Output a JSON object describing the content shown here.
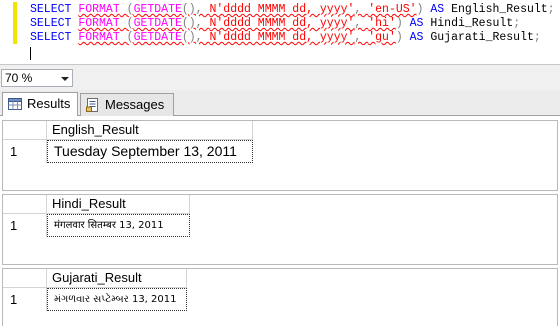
{
  "editor": {
    "lines": [
      {
        "kw1": "SELECT",
        "fn1": "FORMAT",
        "p1": " (",
        "fn2": "GETDATE",
        "p2": "(), ",
        "fmt": "N'dddd MMMM dd, yyyy'",
        "p3": ", ",
        "culture": "'en-US'",
        "p4": ") ",
        "kw2": "AS",
        "alias": " English_Result",
        "end": ";"
      },
      {
        "kw1": "SELECT",
        "fn1": "FORMAT",
        "p1": " (",
        "fn2": "GETDATE",
        "p2": "(), ",
        "fmt": "N'dddd MMMM dd, yyyy'",
        "p3": ", ",
        "culture": "'hi'",
        "p4": ") ",
        "kw2": "AS",
        "alias": " Hindi_Result",
        "end": ";"
      },
      {
        "kw1": "SELECT",
        "fn1": "FORMAT",
        "p1": " (",
        "fn2": "GETDATE",
        "p2": "(), ",
        "fmt": "N'dddd MMMM dd, yyyy'",
        "p3": ", ",
        "culture": "'gu'",
        "p4": ") ",
        "kw2": "AS",
        "alias": " Gujarati_Result",
        "end": ";"
      }
    ],
    "colors": {
      "keyword": "#0000ff",
      "function": "#ff00ff",
      "string": "#ff0000",
      "change_bar": "#f2e400"
    }
  },
  "zoom": {
    "value": "70 %"
  },
  "tabs": [
    {
      "label": "Results",
      "icon": "grid-icon",
      "active": true
    },
    {
      "label": "Messages",
      "icon": "messages-icon",
      "active": false
    }
  ],
  "results": [
    {
      "column": "English_Result",
      "rows": [
        {
          "num": "1",
          "value": "Tuesday September 13, 2011"
        }
      ]
    },
    {
      "column": "Hindi_Result",
      "rows": [
        {
          "num": "1",
          "value": "मंगलवार सितम्बर 13, 2011"
        }
      ]
    },
    {
      "column": "Gujarati_Result",
      "rows": [
        {
          "num": "1",
          "value": "મંગળવાર સપ્ટેમ્બર 13, 2011"
        }
      ]
    }
  ]
}
